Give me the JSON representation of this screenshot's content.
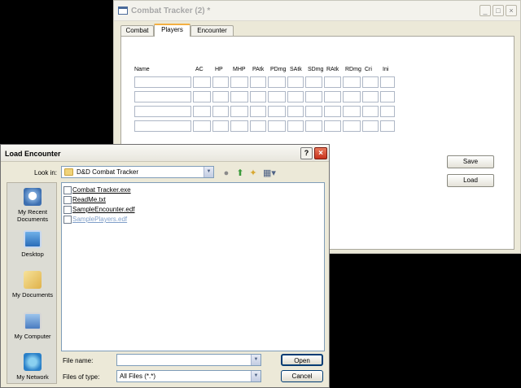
{
  "main_window": {
    "title": "Combat Tracker (2) *",
    "controls": {
      "minimize": "_",
      "maximize": "□",
      "close": "×"
    },
    "tabs": [
      {
        "label": "Combat",
        "active": false
      },
      {
        "label": "Players",
        "active": true
      },
      {
        "label": "Encounter",
        "active": false
      }
    ],
    "columns": [
      "Name",
      "AC",
      "HP",
      "MHP",
      "PAtk",
      "PDmg",
      "SAtk",
      "SDmg",
      "RAtk",
      "RDmg",
      "Cri",
      "Ini"
    ],
    "row_count": 4,
    "buttons": {
      "save": "Save",
      "load": "Load"
    }
  },
  "dialog": {
    "title": "Load Encounter",
    "help": "?",
    "close": "×",
    "look_in_label": "Look in:",
    "look_in_value": "D&D Combat Tracker",
    "places": [
      {
        "name": "recent-documents",
        "label": "My Recent Documents"
      },
      {
        "name": "desktop",
        "label": "Desktop"
      },
      {
        "name": "my-documents",
        "label": "My Documents"
      },
      {
        "name": "my-computer",
        "label": "My Computer"
      },
      {
        "name": "my-network",
        "label": "My Network"
      }
    ],
    "files": [
      {
        "name": "Combat Tracker.exe",
        "muted": false
      },
      {
        "name": "ReadMe.txt",
        "muted": false
      },
      {
        "name": "SampleEncounter.edf",
        "muted": false
      },
      {
        "name": "SamplePlayers.edf",
        "muted": true
      }
    ],
    "file_name_label": "File name:",
    "file_name_value": "",
    "file_type_label": "Files of type:",
    "file_type_value": "All Files (*.*)",
    "open_button": "Open",
    "cancel_button": "Cancel"
  },
  "colors": {
    "tab_accent": "#f4b042",
    "dialog_close": "#c8321c",
    "muted_link": "#7f9ec8"
  }
}
